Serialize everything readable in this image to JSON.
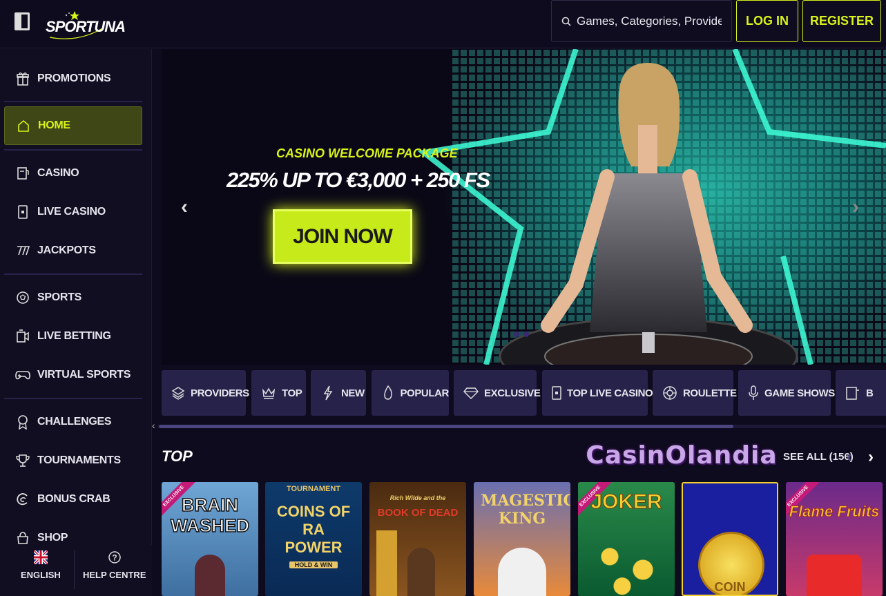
{
  "header": {
    "logo_text": "SPORTUNA",
    "search_placeholder": "Games, Categories, Providers",
    "login_label": "LOG IN",
    "register_label": "REGISTER"
  },
  "sidebar": {
    "items": [
      {
        "label": "PROMOTIONS",
        "icon": "gift-icon"
      },
      {
        "label": "HOME",
        "icon": "home-icon",
        "active": true
      },
      {
        "label": "CASINO",
        "icon": "casino-icon"
      },
      {
        "label": "LIVE CASINO",
        "icon": "live-casino-icon"
      },
      {
        "label": "JACKPOTS",
        "icon": "jackpot-icon"
      },
      {
        "label": "SPORTS",
        "icon": "soccer-ball-icon"
      },
      {
        "label": "LIVE BETTING",
        "icon": "live-betting-icon"
      },
      {
        "label": "VIRTUAL SPORTS",
        "icon": "gamepad-icon"
      },
      {
        "label": "CHALLENGES",
        "icon": "medal-icon"
      },
      {
        "label": "TOURNAMENTS",
        "icon": "trophy-icon"
      },
      {
        "label": "BONUS CRAB",
        "icon": "crab-icon"
      },
      {
        "label": "SHOP",
        "icon": "shop-icon"
      }
    ],
    "footer": {
      "language_label": "ENGLISH",
      "help_label": "HELP CENTRE"
    }
  },
  "hero": {
    "subtitle": "CASINO WELCOME PACKAGE",
    "headline": "225% UP TO €3,000 + 250 FS",
    "cta_label": "JOIN NOW"
  },
  "categories": [
    {
      "label": "PROVIDERS",
      "icon": "layers-icon"
    },
    {
      "label": "TOP",
      "icon": "crown-icon"
    },
    {
      "label": "NEW",
      "icon": "lightning-icon"
    },
    {
      "label": "POPULAR",
      "icon": "flame-icon"
    },
    {
      "label": "EXCLUSIVE",
      "icon": "diamond-icon"
    },
    {
      "label": "TOP LIVE CASINO",
      "icon": "card-icon"
    },
    {
      "label": "ROULETTE",
      "icon": "roulette-icon"
    },
    {
      "label": "GAME SHOWS",
      "icon": "microphone-icon"
    },
    {
      "label": "B",
      "icon": "slot-icon"
    }
  ],
  "top_section": {
    "title": "TOP",
    "watermark": "CasinOlandia",
    "see_all_label": "SEE ALL (156)",
    "games": [
      {
        "title": "BRAIN WASHED",
        "exclusive": true
      },
      {
        "title": "COINS OF RA POWER",
        "tag": "TOURNAMENT",
        "subtitle": "HOLD & WIN"
      },
      {
        "title": "BOOK OF DEAD",
        "subtitle": "Rich Wilde and the"
      },
      {
        "title": "MAGESTIC KING"
      },
      {
        "title": "JOKER",
        "exclusive": true
      },
      {
        "title": "COIN"
      },
      {
        "title": "Flame Fruits",
        "exclusive": true
      }
    ]
  },
  "colors": {
    "accent": "#d8f31a",
    "background": "#0f0b1e",
    "sidebar": "#120e22",
    "tab_bg": "#26224a"
  }
}
